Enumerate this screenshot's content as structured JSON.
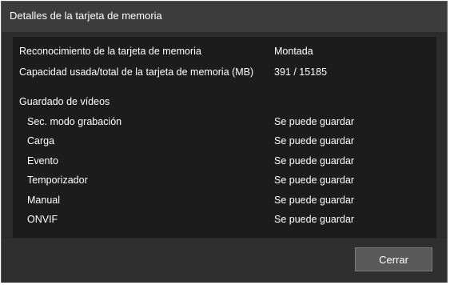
{
  "dialog": {
    "title": "Detalles de la tarjeta de memoria"
  },
  "card": {
    "recognition_label": "Reconocimiento de la tarjeta de memoria",
    "recognition_value": "Montada",
    "capacity_label": "Capacidad usada/total de la tarjeta de memoria (MB)",
    "capacity_value": "391 / 15185"
  },
  "video_saving": {
    "heading": "Guardado de vídeos",
    "items": [
      {
        "label": "Sec. modo grabación",
        "status": "Se puede guardar"
      },
      {
        "label": "Carga",
        "status": "Se puede guardar"
      },
      {
        "label": "Evento",
        "status": "Se puede guardar"
      },
      {
        "label": "Temporizador",
        "status": "Se puede guardar"
      },
      {
        "label": "Manual",
        "status": "Se puede guardar"
      },
      {
        "label": "ONVIF",
        "status": "Se puede guardar"
      }
    ]
  },
  "footer": {
    "close_label": "Cerrar"
  }
}
